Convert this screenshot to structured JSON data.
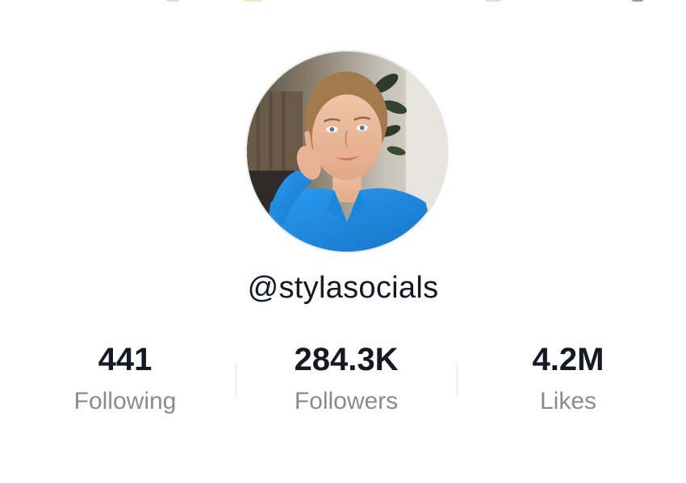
{
  "profile": {
    "username": "@stylasocials",
    "avatar_alt": "profile-photo"
  },
  "stats": [
    {
      "value": "441",
      "label": "Following"
    },
    {
      "value": "284.3K",
      "label": "Followers"
    },
    {
      "value": "4.2M",
      "label": "Likes"
    }
  ],
  "colors": {
    "text": "#161823",
    "secondary_text": "#8a8b91",
    "divider": "#e3e3e4",
    "shirt": "#1f8fe0"
  }
}
